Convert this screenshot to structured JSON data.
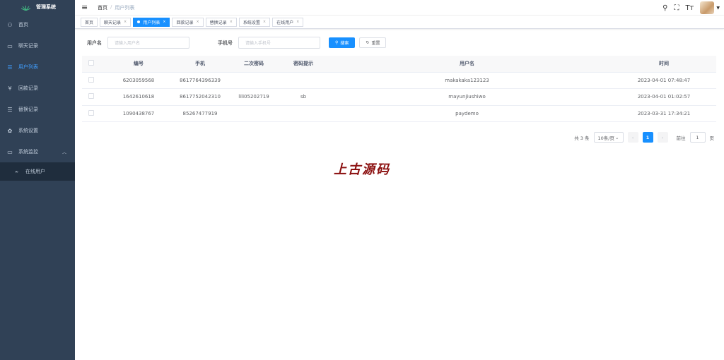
{
  "app": {
    "title": "管理系统"
  },
  "sidebar": {
    "items": [
      {
        "label": "首页",
        "icon": "dashboard-icon",
        "glyph": "⚇"
      },
      {
        "label": "聊天记录",
        "icon": "chat-icon",
        "glyph": "▭"
      },
      {
        "label": "用户列表",
        "icon": "list-icon",
        "glyph": "☰"
      },
      {
        "label": "回款记录",
        "icon": "yen-icon",
        "glyph": "¥"
      },
      {
        "label": "替换记录",
        "icon": "list-icon",
        "glyph": "☰"
      },
      {
        "label": "系统设置",
        "icon": "gear-icon",
        "glyph": "✿"
      },
      {
        "label": "系统监控",
        "icon": "monitor-icon",
        "glyph": "▭"
      }
    ],
    "submenu": {
      "label": "在线用户",
      "icon": "online-icon",
      "glyph": "∞"
    }
  },
  "header": {
    "breadcrumb": [
      "首页",
      "用户列表"
    ]
  },
  "tags": [
    "首页",
    "聊天记录",
    "用户列表",
    "回款记录",
    "替换记录",
    "系统设置",
    "在线用户"
  ],
  "filters": {
    "username_label": "用户名",
    "username_placeholder": "请输入用户名",
    "phone_label": "手机号",
    "phone_placeholder": "请输入手机号",
    "search_label": "搜索",
    "reset_label": "重置"
  },
  "table": {
    "headers": [
      "编号",
      "手机",
      "二次密码",
      "密码提示",
      "用户名",
      "时间"
    ],
    "rows": [
      [
        "6203059568",
        "8617764396339",
        "",
        "",
        "makakaka123123",
        "2023-04-01 07:48:47"
      ],
      [
        "1642610618",
        "8617752042310",
        "lili05202719",
        "sb",
        "mayunjiushiwo",
        "2023-04-01 01:02:57"
      ],
      [
        "1090438767",
        "85267477919",
        "",
        "",
        "paydemo",
        "2023-03-31 17:34:21"
      ]
    ]
  },
  "pagination": {
    "total": "共 3 条",
    "page_size": "10条/页",
    "current": "1",
    "goto_label": "前往",
    "goto_value": "1",
    "page_suffix": "页"
  },
  "watermark": "上古源码",
  "colors": {
    "sidebar_bg": "#304156",
    "accent": "#1890ff",
    "watermark": "#8b0f0f"
  }
}
